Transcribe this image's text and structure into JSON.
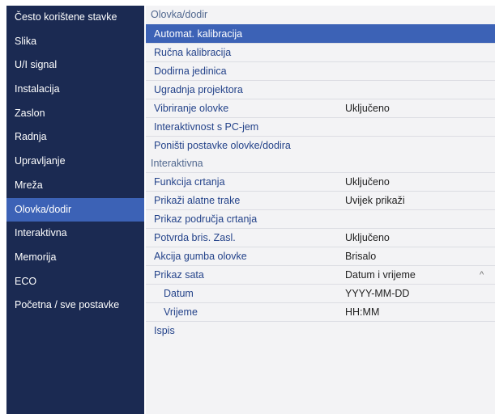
{
  "sidebar": {
    "items": [
      {
        "label": "Često korištene stavke"
      },
      {
        "label": "Slika"
      },
      {
        "label": "U/I signal"
      },
      {
        "label": "Instalacija"
      },
      {
        "label": "Zaslon"
      },
      {
        "label": "Radnja"
      },
      {
        "label": "Upravljanje"
      },
      {
        "label": "Mreža"
      },
      {
        "label": "Olovka/dodir",
        "selected": true
      },
      {
        "label": "Interaktivna"
      },
      {
        "label": "Memorija"
      },
      {
        "label": "ECO"
      },
      {
        "label": "Početna / sve postavke"
      }
    ]
  },
  "main": {
    "section1": {
      "title": "Olovka/dodir",
      "items": [
        {
          "label": "Automat. kalibracija",
          "value": "",
          "highlighted": true
        },
        {
          "label": "Ručna kalibracija",
          "value": ""
        },
        {
          "label": "Dodirna jedinica",
          "value": ""
        },
        {
          "label": "Ugradnja projektora",
          "value": ""
        },
        {
          "label": "Vibriranje olovke",
          "value": "Uključeno"
        },
        {
          "label": "Interaktivnost s PC-jem",
          "value": ""
        },
        {
          "label": "Poništi postavke olovke/dodira",
          "value": ""
        }
      ]
    },
    "section2": {
      "title": "Interaktivna",
      "items": [
        {
          "label": "Funkcija crtanja",
          "value": "Uključeno"
        },
        {
          "label": "Prikaži alatne trake",
          "value": "Uvijek prikaži"
        },
        {
          "label": "Prikaz područja crtanja",
          "value": ""
        },
        {
          "label": "Potvrda bris. Zasl.",
          "value": "Uključeno"
        },
        {
          "label": "Akcija gumba olovke",
          "value": "Brisalo"
        },
        {
          "label": "Prikaz sata",
          "value": "Datum i vrijeme",
          "expanded": true,
          "arrow": "^"
        },
        {
          "label": "Datum",
          "value": "YYYY-MM-DD",
          "indent": true
        },
        {
          "label": "Vrijeme",
          "value": "HH:MM",
          "indent": true
        },
        {
          "label": "Ispis",
          "value": ""
        }
      ]
    }
  },
  "colors": {
    "sidebar_bg": "#1b2a52",
    "selected_bg": "#3c62b6",
    "panel_bg": "#f3f3f5",
    "item_text": "#24438a",
    "header_text": "#51688f"
  }
}
